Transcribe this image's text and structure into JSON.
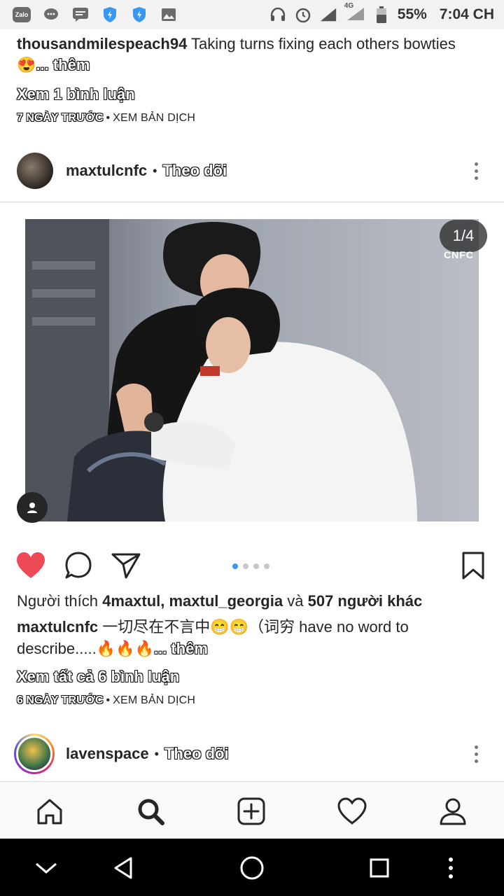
{
  "status_bar": {
    "left_icons": [
      "zalo-icon",
      "chat-icon",
      "message-icon",
      "shield-icon",
      "shield-icon",
      "image-icon"
    ],
    "zalo_label": "Zalo",
    "network": "4G",
    "battery": "55%",
    "time": "7:04 CH"
  },
  "prev_post": {
    "username": "thousandmilespeach94",
    "caption": "Taking turns fixing each others bowties",
    "emoji": "😍",
    "more": "... thêm",
    "view_comments": "Xem 1 bình luận",
    "time_ago": "7 NGÀY TRƯỚC",
    "separator": "•",
    "translate": "XEM BẢN DỊCH"
  },
  "post": {
    "username": "maxtulcnfc",
    "separator": "•",
    "follow": "Theo dõi",
    "photo_counter": "1/4",
    "watermark": "CNFC",
    "carousel": {
      "count": 4,
      "active": 0
    },
    "likes_prefix": "Người thích",
    "likes_users": "4maxtul, maxtul_georgia",
    "likes_and": "và",
    "likes_others": "507 người khác",
    "caption_username": "maxtulcnfc",
    "caption_text": "一切尽在不言中😁😁（词穷 have no word to describe.....🔥🔥🔥",
    "caption_more": "... thêm",
    "view_all_comments": "Xem tất cả 6 bình luận",
    "time_ago": "6 NGÀY TRƯỚC",
    "translate": "XEM BẢN DỊCH"
  },
  "next_post": {
    "username": "lavenspace",
    "separator": "•",
    "follow": "Theo dõi"
  },
  "tabbar": [
    "home-icon",
    "search-icon",
    "add-post-icon",
    "activity-heart-icon",
    "profile-icon"
  ],
  "colors": {
    "like_red": "#ed4956",
    "active_dot": "#3897f0",
    "text": "#262626"
  }
}
